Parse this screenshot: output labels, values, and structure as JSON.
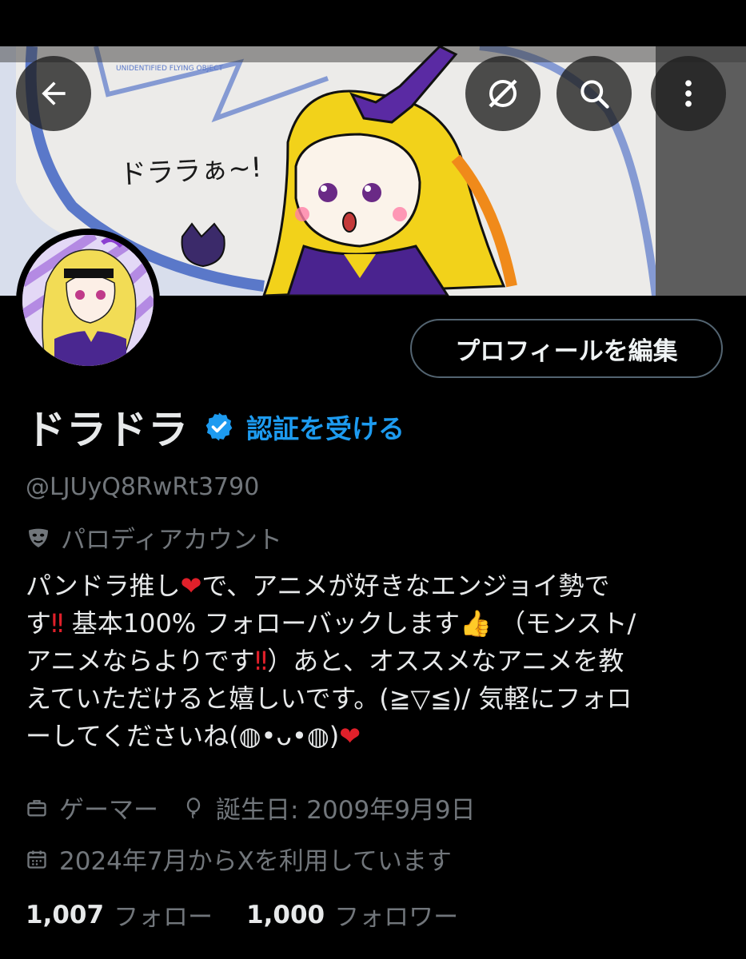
{
  "profile": {
    "display_name": "ドラドラ",
    "get_verified_label": "認証を受ける",
    "handle": "@LJUyQ8RwRt3790",
    "account_label": "パロディアカウント",
    "edit_profile_label": "プロフィールを編集",
    "bio_lines": [
      [
        "パンドラ推し",
        "❤",
        "で、アニメが好きなエンジョイ勢で"
      ],
      [
        "す",
        "‼",
        " 基本100% フォローバックします",
        "👍",
        " （モンスト/"
      ],
      [
        "アニメならよりです",
        "‼",
        "）あと、オススメなアニメを教"
      ],
      [
        "えていただけると嬉しいです。(≧▽≦)/ 気軽にフォロ"
      ],
      [
        "ーしてくださいね(◍•ᴗ•◍)",
        "❤"
      ]
    ],
    "category": "ゲーマー",
    "birthday": "誕生日: 2009年9月9日",
    "joined": "2024年7月からXを利用しています",
    "following_count": "1,007",
    "following_label": "フォロー",
    "followers_count": "1,000",
    "followers_label": "フォロワー"
  },
  "banner": {
    "handwritten_text": "ドララぁ~!",
    "badge_text": "UNIDENTIFIED FLYING OBJECT"
  },
  "icons": {
    "back": "arrow-left-icon",
    "grok": "grok-icon",
    "search": "search-icon",
    "more": "more-vertical-icon",
    "verified": "verified-badge-icon",
    "parody": "mask-icon",
    "category": "briefcase-icon",
    "birthday": "balloon-icon",
    "joined": "calendar-icon"
  },
  "colors": {
    "background": "#000000",
    "text": "#e7e9ea",
    "muted": "#71767b",
    "accent": "#1d9bf0"
  }
}
